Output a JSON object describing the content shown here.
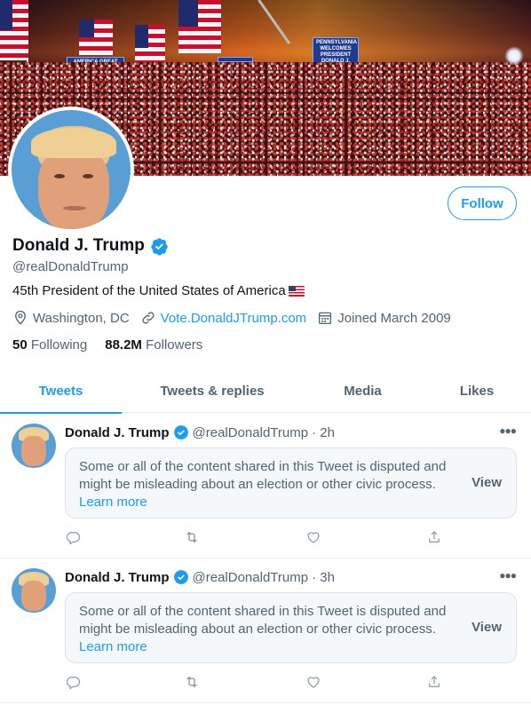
{
  "banner": {
    "signs": [
      "AMERICA GREAT AGAIN",
      "PENNSYLVANIA WELCOMES PRESIDENT DONALD J. TRUMP"
    ]
  },
  "profile": {
    "name": "Donald J. Trump",
    "handle": "@realDonaldTrump",
    "bio": "45th President of the United States of America",
    "location": "Washington, DC",
    "website": "Vote.DonaldJTrump.com",
    "joined": "Joined March 2009",
    "following_count": "50",
    "following_label": "Following",
    "followers_count": "88.2M",
    "followers_label": "Followers",
    "follow_label": "Follow"
  },
  "tabs": [
    {
      "label": "Tweets",
      "active": true
    },
    {
      "label": "Tweets & replies",
      "active": false
    },
    {
      "label": "Media",
      "active": false
    },
    {
      "label": "Likes",
      "active": false
    }
  ],
  "tweets": [
    {
      "name": "Donald J. Trump",
      "handle": "@realDonaldTrump",
      "time": "· 2h",
      "notice": "Some or all of the content shared in this Tweet is disputed and might be misleading about an election or other civic process.",
      "learn_more": "Learn more",
      "view": "View"
    },
    {
      "name": "Donald J. Trump",
      "handle": "@realDonaldTrump",
      "time": "· 3h",
      "notice": "Some or all of the content shared in this Tweet is disputed and might be misleading about an election or other civic process.",
      "learn_more": "Learn more",
      "view": "View"
    }
  ],
  "colors": {
    "accent": "#1d9bf0",
    "secondary_text": "#536471",
    "border": "#e6ecf0"
  },
  "icons": [
    "verified-badge-icon",
    "location-icon",
    "link-icon",
    "calendar-icon",
    "reply-icon",
    "retweet-icon",
    "like-icon",
    "share-icon",
    "more-icon"
  ]
}
